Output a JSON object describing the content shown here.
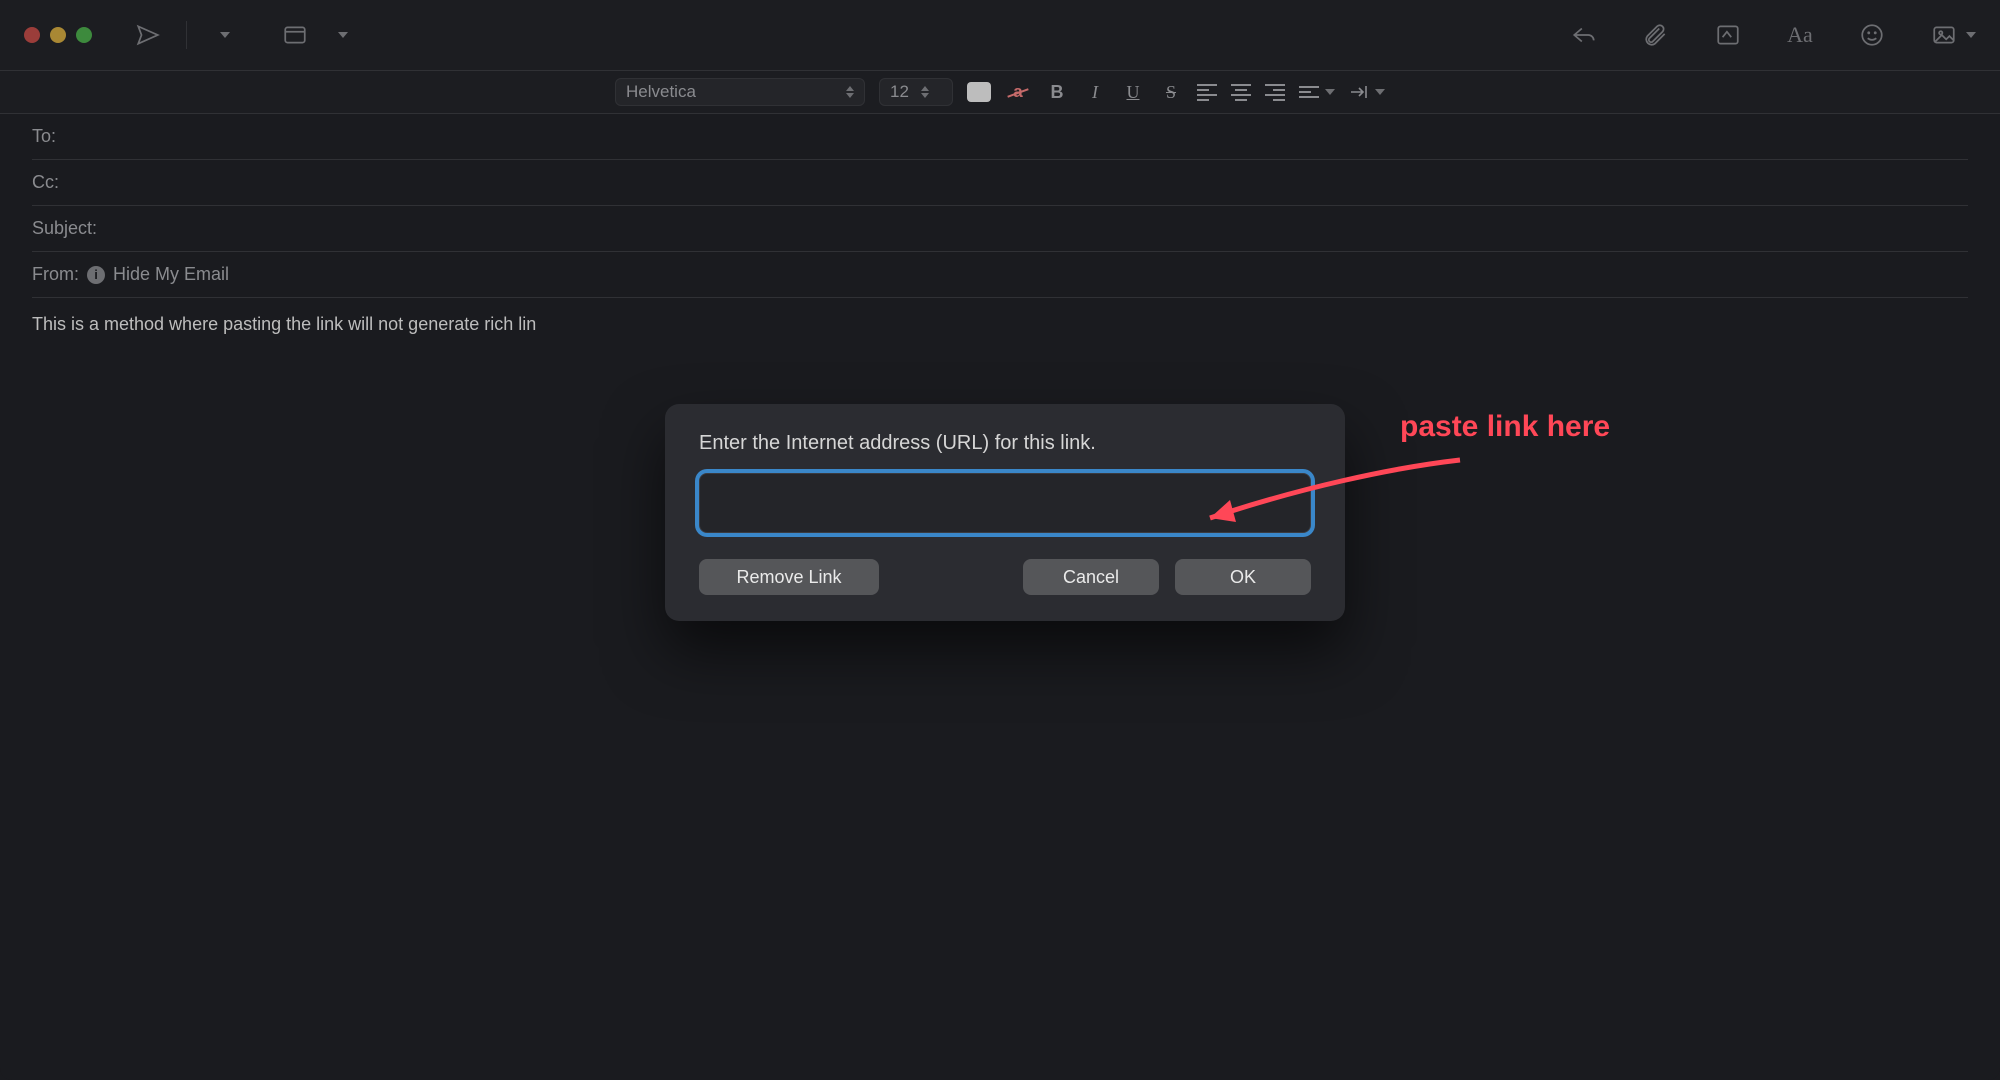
{
  "toolbar": {
    "icons": {
      "send": "send-icon",
      "header_dropdown": "chevron-down-icon",
      "header_template": "template-icon",
      "reply": "reply-icon",
      "attach": "paperclip-icon",
      "markup": "markup-icon",
      "format": "format-icon",
      "emoji": "emoji-icon",
      "photo": "photo-browser-icon"
    }
  },
  "formatbar": {
    "font_name": "Helvetica",
    "font_size": "12",
    "bold": "B",
    "italic": "I",
    "underline": "U",
    "strike": "S",
    "strike_a": "a"
  },
  "headers": {
    "to_label": "To:",
    "cc_label": "Cc:",
    "subject_label": "Subject:",
    "from_label": "From:",
    "from_value": "Hide My Email"
  },
  "body_text": "This is a method where pasting the link will not generate rich lin",
  "dialog": {
    "prompt": "Enter the Internet address (URL) for this link.",
    "url_value": "",
    "remove_label": "Remove Link",
    "cancel_label": "Cancel",
    "ok_label": "OK"
  },
  "annotation": {
    "text": "paste link here"
  }
}
